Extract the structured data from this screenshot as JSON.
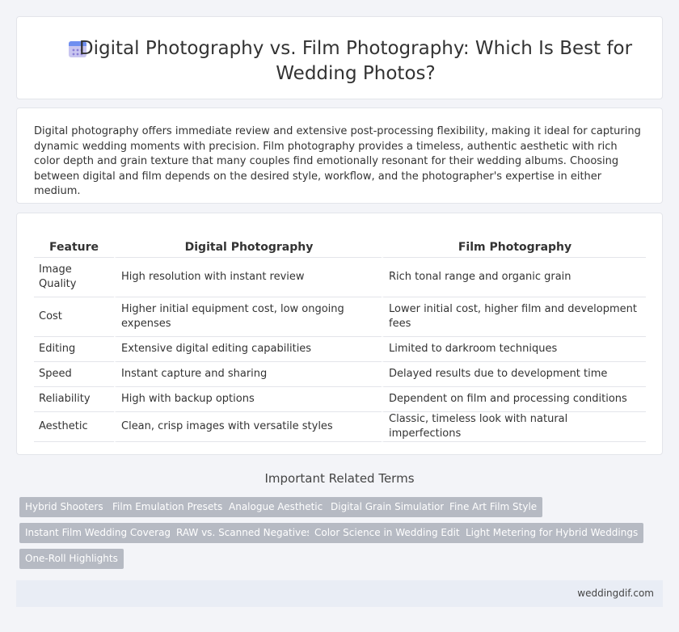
{
  "header": {
    "title": "Digital Photography vs. Film Photography: Which Is Best for Wedding Photos?",
    "icon": "calendar-icon"
  },
  "intro": {
    "text": "Digital photography offers immediate review and extensive post-processing flexibility, making it ideal for capturing dynamic wedding moments with precision. Film photography provides a timeless, authentic aesthetic with rich color depth and grain texture that many couples find emotionally resonant for their wedding albums. Choosing between digital and film depends on the desired style, workflow, and the photographer's expertise in either medium."
  },
  "table": {
    "headers": [
      "Feature",
      "Digital Photography",
      "Film Photography"
    ],
    "rows": [
      [
        "Image Quality",
        "High resolution with instant review",
        "Rich tonal range and organic grain"
      ],
      [
        "Cost",
        "Higher initial equipment cost, low ongoing expenses",
        "Lower initial cost, higher film and development fees"
      ],
      [
        "Editing",
        "Extensive digital editing capabilities",
        "Limited to darkroom techniques"
      ],
      [
        "Speed",
        "Instant capture and sharing",
        "Delayed results due to development time"
      ],
      [
        "Reliability",
        "High with backup options",
        "Dependent on film and processing conditions"
      ],
      [
        "Aesthetic",
        "Clean, crisp images with versatile styles",
        "Classic, timeless look with natural imperfections"
      ]
    ]
  },
  "related": {
    "heading": "Important Related Terms",
    "tags": [
      "Hybrid Shooters",
      "Film Emulation Presets",
      "Analogue Aesthetic",
      "Digital Grain Simulation",
      "Fine Art Film Style",
      "Instant Film Wedding Coverage",
      "RAW vs. Scanned Negatives",
      "Color Science in Wedding Edits",
      "Light Metering for Hybrid Weddings",
      "One-Roll Highlights"
    ]
  },
  "footer": {
    "site": "weddingdif.com"
  },
  "colors": {
    "background": "#f3f4f8",
    "tag_bg": "#b6bac3",
    "footer_bg": "#e9edf5"
  }
}
